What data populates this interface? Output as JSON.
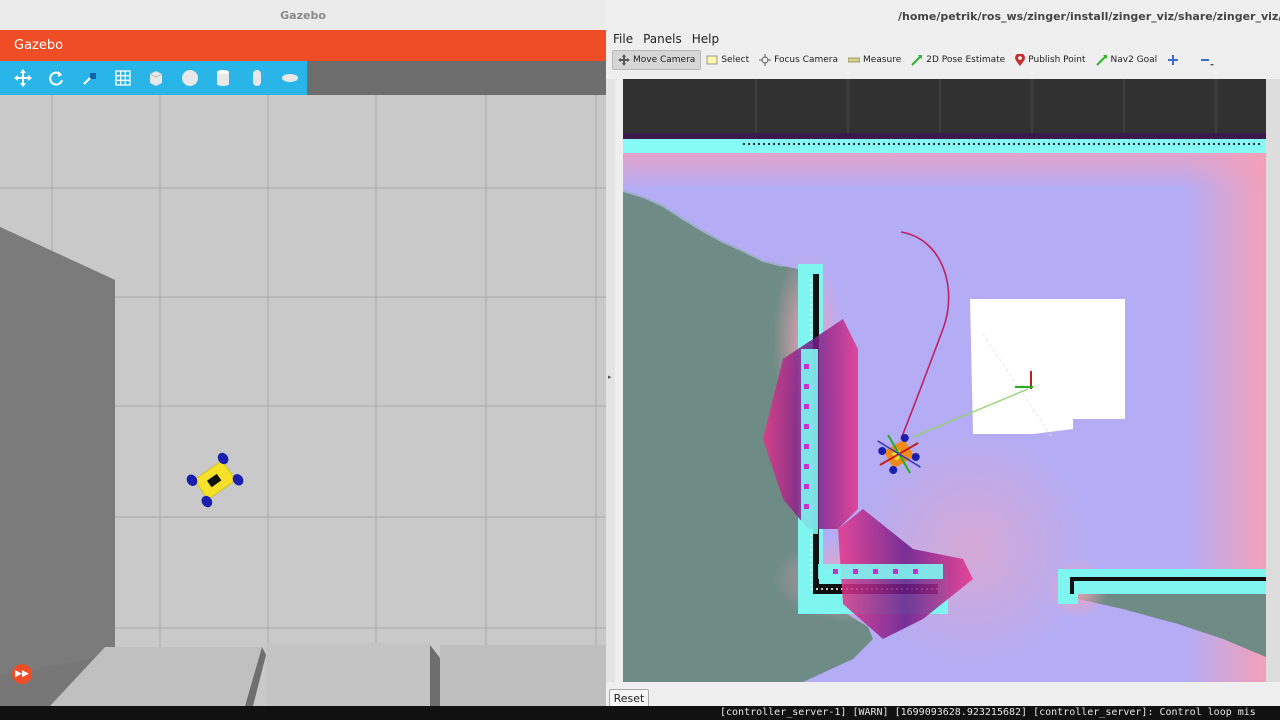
{
  "gazebo": {
    "window_title": "Gazebo",
    "app_name": "Gazebo",
    "toolbar": [
      {
        "name": "translate-mode",
        "icon": "move-arrows-icon"
      },
      {
        "name": "rotate-mode",
        "icon": "rotate-icon"
      },
      {
        "name": "scale-mode",
        "icon": "scale-icon"
      },
      {
        "name": "snap-grid",
        "icon": "grid-icon"
      },
      {
        "name": "box-shape",
        "icon": "box-icon"
      },
      {
        "name": "sphere-shape",
        "icon": "sphere-icon"
      },
      {
        "name": "cylinder-shape",
        "icon": "cylinder-icon"
      },
      {
        "name": "capsule-shape",
        "icon": "capsule-icon"
      },
      {
        "name": "ellipsoid-shape",
        "icon": "ellipsoid-icon"
      }
    ],
    "play_control": {
      "icon": "fast-forward-icon"
    },
    "colors": {
      "header": "#ee4d26",
      "toolbar": "#29b5e8",
      "robot_body": "#f5e12a",
      "robot_wheels": "#1a1fb0"
    }
  },
  "rviz": {
    "window_title": "/home/petrik/ros_ws/zinger/install/zinger_viz/share/zinger_viz/rviz/",
    "menu": [
      "File",
      "Panels",
      "Help"
    ],
    "tools": [
      {
        "label": "Move Camera",
        "icon": "move-camera-icon",
        "active": true
      },
      {
        "label": "Select",
        "icon": "select-icon",
        "active": false
      },
      {
        "label": "Focus Camera",
        "icon": "focus-camera-icon",
        "active": false
      },
      {
        "label": "Measure",
        "icon": "measure-icon",
        "active": false
      },
      {
        "label": "2D Pose Estimate",
        "icon": "pose-estimate-icon",
        "active": false
      },
      {
        "label": "Publish Point",
        "icon": "publish-point-icon",
        "active": false
      },
      {
        "label": "Nav2 Goal",
        "icon": "nav2-goal-icon",
        "active": false
      }
    ],
    "extra_tools": [
      {
        "icon": "plus-icon"
      },
      {
        "icon": "minus-icon"
      }
    ],
    "reset_label": "Reset",
    "colors": {
      "costmap_free": "#b4acf4",
      "inflation": "#f0a8c8",
      "lethal": "#7ff5f0",
      "static_map": "#6f8b86",
      "plan_path": "#c02060"
    }
  },
  "terminal": {
    "log_line": "[controller_server-1] [WARN] [1699093628.923215682] [controller_server]: Control loop mis"
  }
}
